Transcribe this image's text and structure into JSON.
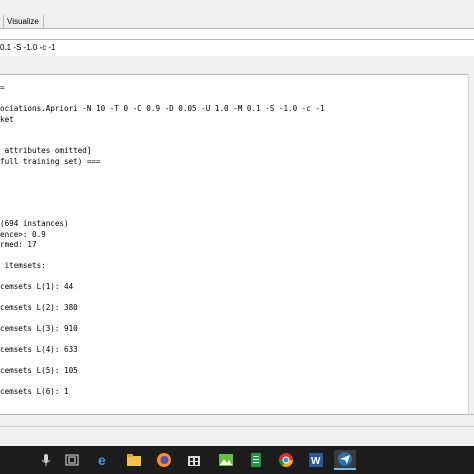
{
  "tabs": {
    "visualize_label": "Visualize"
  },
  "config": {
    "command_text": "0.1 -S -1.0 -c -1"
  },
  "output": {
    "lines": [
      "=",
      "",
      "ociations.Apriori -N 10 -T 0 -C 0.9 -D 0.05 -U 1.0 -M 0.1 -S -1.0 -c -1",
      "ket",
      "",
      "",
      " attributes omitted]",
      "full training set) ===",
      "",
      "",
      "",
      "",
      "",
      "(694 instances)",
      "ence>: 0.9",
      "rmed: 17",
      "",
      " itemsets:",
      "",
      "cemsets L(1): 44",
      "",
      "cemsets L(2): 380",
      "",
      "cemsets L(3): 910",
      "",
      "cemsets L(4): 633",
      "",
      "cemsets L(5): 105",
      "",
      "cemsets L(6): 1"
    ]
  },
  "taskbar": {
    "icons": [
      "microphone-icon",
      "task-view-icon",
      "edge-browser-icon",
      "file-explorer-icon",
      "firefox-icon",
      "store-icon",
      "landscape-app-icon",
      "green-document-icon",
      "chrome-icon",
      "word-icon",
      "paper-plane-app-icon"
    ]
  }
}
